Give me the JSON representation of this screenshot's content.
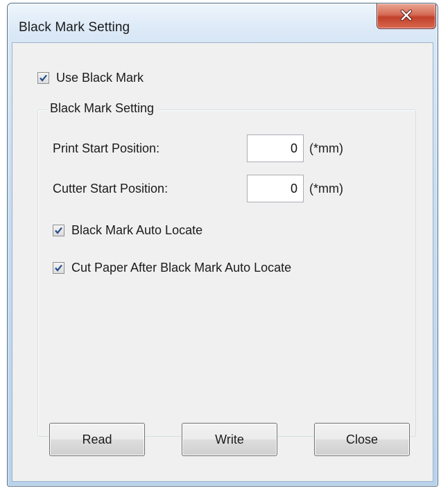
{
  "window": {
    "title": "Black Mark Setting",
    "close_icon": "close-x-icon"
  },
  "use_black_mark": {
    "label": "Use Black Mark",
    "checked": true
  },
  "group": {
    "legend": "Black Mark Setting",
    "print_start": {
      "label": "Print Start Position:",
      "value": "0",
      "unit": "(*mm)"
    },
    "cutter_start": {
      "label": "Cutter Start Position:",
      "value": "0",
      "unit": "(*mm)"
    },
    "auto_locate": {
      "label": "Black Mark Auto Locate",
      "checked": true
    },
    "cut_paper": {
      "label": "Cut Paper After Black Mark Auto Locate",
      "checked": true
    }
  },
  "buttons": {
    "read": "Read",
    "write": "Write",
    "close": "Close"
  },
  "colors": {
    "close_button": "#c2412a",
    "checkmark": "#1f4a8a",
    "dialog_face": "#f0f0f0"
  }
}
